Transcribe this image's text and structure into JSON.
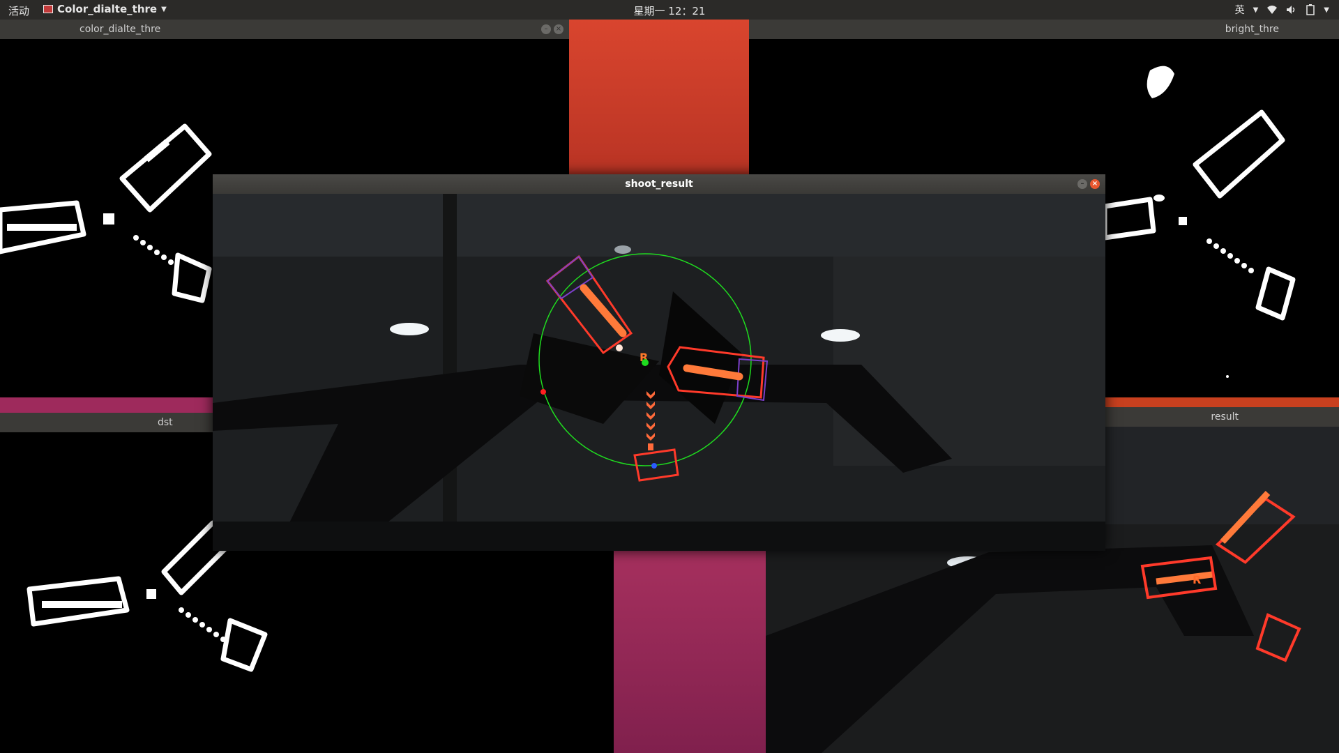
{
  "topbar": {
    "activities": "活动",
    "app_menu": "Color_dialte_thre",
    "clock": "星期一 12：21",
    "input_method": "英"
  },
  "windows": {
    "color_dialte_thre": {
      "title": "color_dialte_thre"
    },
    "bright_thre": {
      "title": "bright_thre"
    },
    "dst": {
      "title": "dst"
    },
    "result": {
      "title": "result"
    },
    "shoot_result": {
      "title": "shoot_result"
    }
  },
  "colors": {
    "wallpaper_orange": "#c93a28",
    "wallpaper_magenta": "#8e2556",
    "detection_red": "#ff3a2a",
    "circle_green": "#1fdc1f",
    "close_button": "#e8572f"
  },
  "icons": [
    "wifi-icon",
    "volume-icon",
    "battery-icon",
    "close-icon",
    "minimize-icon"
  ]
}
